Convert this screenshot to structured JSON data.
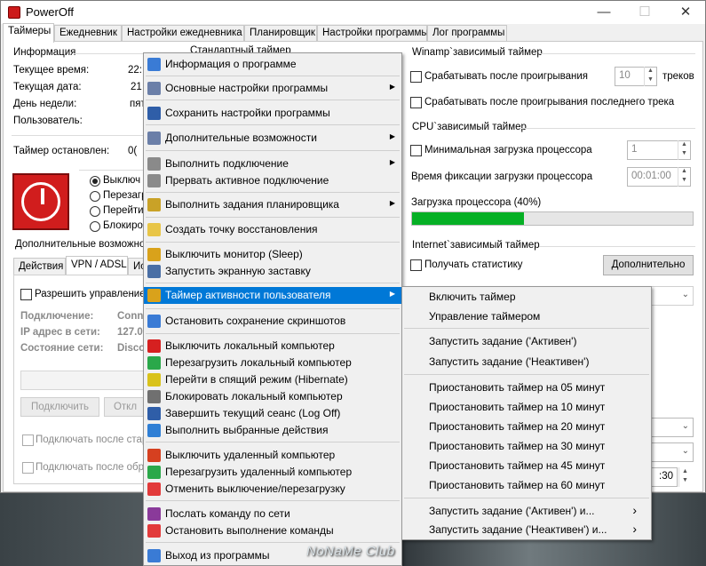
{
  "window": {
    "title": "PowerOff",
    "minimize": "—",
    "maximize": "☐",
    "close": "✕"
  },
  "tabs": [
    "Таймеры",
    "Ежедневник",
    "Настройки ежедневника",
    "Планировщик",
    "Настройки программы",
    "Лог программы"
  ],
  "info": {
    "header": "Информация",
    "rows": [
      {
        "label": "Текущее время:",
        "value": "22:"
      },
      {
        "label": "Текущая дата:",
        "value": "21"
      },
      {
        "label": "День недели:",
        "value": "пят"
      },
      {
        "label": "Пользователь:",
        "value": ""
      }
    ],
    "timer_status_label": "Таймер остановлен:",
    "timer_status_value": "0("
  },
  "standard_timer": {
    "header": "Стандартный таймер"
  },
  "actions_radio": [
    "Выключ",
    "Перезагр",
    "Перейти",
    "Блокиро"
  ],
  "extra": {
    "header": "Дополнительные возможно",
    "subtabs": [
      "Действия",
      "VPN / ADSL",
      "Ис"
    ],
    "allow_control": "Разрешить управление с",
    "vpn_rows": [
      {
        "label": "Подключение:",
        "value": "Conn"
      },
      {
        "label": "IP адрес в сети:",
        "value": "127.0"
      },
      {
        "label": "Состояние сети:",
        "value": "Disco"
      }
    ],
    "connect_btn": "Подключить",
    "disconnect_btn": "Откл",
    "check_after_start": "Подключать после стар",
    "check_after_break": "Подключать после обры"
  },
  "winamp": {
    "header": "Winamp`зависимый таймер",
    "after_play": "Срабатывать после проигрывания",
    "tracks_value": "10",
    "tracks_label": "треков",
    "after_last": "Срабатывать после проигрывания последнего трека"
  },
  "cpu": {
    "header": "CPU`зависимый таймер",
    "min_load": "Минимальная загрузка процессора",
    "min_value": "1",
    "fix_time_label": "Время фиксации загрузки процессора",
    "fix_time_value": "00:01:00",
    "load_label": "Загрузка процессора (40%)",
    "load_percent": 40
  },
  "internet": {
    "header": "Internet`зависимый таймер",
    "get_stats": "Получать статистику",
    "more_btn": "Дополнительно"
  },
  "right_bottom": {
    "time_fragment": ":30"
  },
  "context_menu": [
    {
      "label": "Информация о программе",
      "icon": "info-icon",
      "color": "#3a7bd5"
    },
    {
      "label": "Основные настройки программы",
      "icon": "settings-icon",
      "color": "#6b7fa8",
      "submenu": true
    },
    {
      "label": "Сохранить настройки программы",
      "icon": "save-icon",
      "color": "#2f5ea8"
    },
    {
      "label": "Дополнительные возможности",
      "icon": "extras-icon",
      "color": "#6b7fa8",
      "submenu": true
    },
    {
      "label": "Выполнить подключение",
      "icon": "connect-icon",
      "color": "#8a8a8a",
      "submenu": true
    },
    {
      "label": "Прервать активное подключение",
      "icon": "disconnect-icon",
      "color": "#8a8a8a"
    },
    {
      "label": "Выполнить задания планировщика",
      "icon": "scheduler-icon",
      "color": "#c9a227",
      "submenu": true
    },
    {
      "label": "Создать точку восстановления",
      "icon": "restore-point-icon",
      "color": "#e8c547"
    },
    {
      "label": "Выключить монитор (Sleep)",
      "icon": "monitor-icon",
      "color": "#d9a21b"
    },
    {
      "label": "Запустить экранную заставку",
      "icon": "screensaver-icon",
      "color": "#4a6fa5"
    },
    {
      "label": "Таймер активности пользователя",
      "icon": "user-timer-icon",
      "color": "#d9a21b",
      "submenu": true,
      "highlighted": true
    },
    {
      "label": "Остановить сохранение скриншотов",
      "icon": "screenshot-icon",
      "color": "#3a7bd5"
    },
    {
      "label": "Выключить локальный компьютер",
      "icon": "power-icon",
      "color": "#d62020"
    },
    {
      "label": "Перезагрузить локальный компьютер",
      "icon": "restart-icon",
      "color": "#2aa84a"
    },
    {
      "label": "Перейти в спящий режим (Hibernate)",
      "icon": "hibernate-icon",
      "color": "#d9c21b"
    },
    {
      "label": "Блокировать локальный компьютер",
      "icon": "lock-icon",
      "color": "#707070"
    },
    {
      "label": "Завершить текущий сеанс (Log Off)",
      "icon": "logoff-icon",
      "color": "#2f5ea8"
    },
    {
      "label": "Выполнить выбранные действия",
      "icon": "run-actions-icon",
      "color": "#2f7fd5"
    },
    {
      "label": "Выключить удаленный компьютер",
      "icon": "remote-power-icon",
      "color": "#d64020"
    },
    {
      "label": "Перезагрузить удаленный компьютер",
      "icon": "remote-restart-icon",
      "color": "#2aa84a"
    },
    {
      "label": "Отменить выключение/перезагрузку",
      "icon": "cancel-icon",
      "color": "#e23a3a"
    },
    {
      "label": "Послать команду по сети",
      "icon": "network-command-icon",
      "color": "#8a3a9a"
    },
    {
      "label": "Остановить выполнение команды",
      "icon": "stop-command-icon",
      "color": "#e23a3a"
    },
    {
      "label": "Выход из программы",
      "icon": "exit-icon",
      "color": "#3a7bd5"
    }
  ],
  "submenu": [
    {
      "label": "Включить таймер"
    },
    {
      "label": "Управление таймером"
    },
    {
      "label": "Запустить задание ('Активен')"
    },
    {
      "label": "Запустить задание ('Неактивен')"
    },
    {
      "label": "Приостановить таймер на 05 минут"
    },
    {
      "label": "Приостановить таймер на 10 минут"
    },
    {
      "label": "Приостановить таймер на 20 минут"
    },
    {
      "label": "Приостановить таймер на 30 минут"
    },
    {
      "label": "Приостановить таймер на 45 минут"
    },
    {
      "label": "Приостановить таймер на 60 минут"
    },
    {
      "label": "Запустить задание ('Активен') и...",
      "submenu": true
    },
    {
      "label": "Запустить задание ('Неактивен') и...",
      "submenu": true
    }
  ],
  "watermark": "NoNaMe Club"
}
